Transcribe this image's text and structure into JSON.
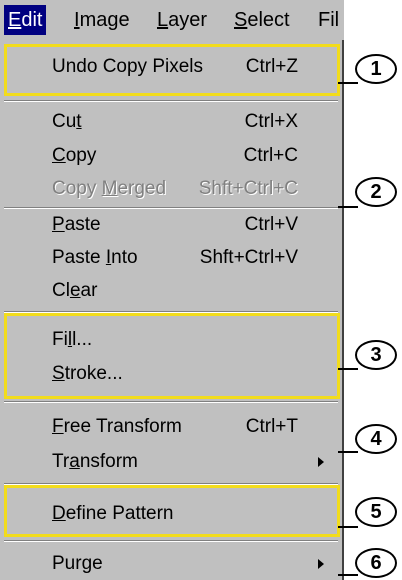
{
  "menubar": [
    {
      "name": "menu-edit",
      "pre": "",
      "acc": "E",
      "post": "dit",
      "active": true
    },
    {
      "name": "menu-image",
      "pre": "",
      "acc": "I",
      "post": "mage",
      "active": false
    },
    {
      "name": "menu-layer",
      "pre": "",
      "acc": "L",
      "post": "ayer",
      "active": false
    },
    {
      "name": "menu-select",
      "pre": "",
      "acc": "S",
      "post": "elect",
      "active": false
    },
    {
      "name": "menu-filter",
      "pre": "Fil",
      "acc": "",
      "post": "",
      "active": false
    }
  ],
  "items": [
    {
      "name": "undo-copy-pixels",
      "pre": "",
      "acc": "",
      "post": "Undo Copy Pixels",
      "shortcut": "Ctrl+Z",
      "disabled": false,
      "submenu": false
    },
    {
      "name": "cut",
      "pre": "Cu",
      "acc": "t",
      "post": "",
      "shortcut": "Ctrl+X",
      "disabled": false,
      "submenu": false
    },
    {
      "name": "copy",
      "pre": "",
      "acc": "C",
      "post": "opy",
      "shortcut": "Ctrl+C",
      "disabled": false,
      "submenu": false
    },
    {
      "name": "copy-merged",
      "pre": "Copy ",
      "acc": "M",
      "post": "erged",
      "shortcut": "Shft+Ctrl+C",
      "disabled": true,
      "submenu": false
    },
    {
      "name": "paste",
      "pre": "",
      "acc": "P",
      "post": "aste",
      "shortcut": "Ctrl+V",
      "disabled": false,
      "submenu": false
    },
    {
      "name": "paste-into",
      "pre": "Paste ",
      "acc": "I",
      "post": "nto",
      "shortcut": "Shft+Ctrl+V",
      "disabled": false,
      "submenu": false
    },
    {
      "name": "clear",
      "pre": "Cl",
      "acc": "e",
      "post": "ar",
      "shortcut": "",
      "disabled": false,
      "submenu": false
    },
    {
      "name": "fill",
      "pre": "Fi",
      "acc": "l",
      "post": "l...",
      "shortcut": "",
      "disabled": false,
      "submenu": false
    },
    {
      "name": "stroke",
      "pre": "",
      "acc": "S",
      "post": "troke...",
      "shortcut": "",
      "disabled": false,
      "submenu": false
    },
    {
      "name": "free-transform",
      "pre": "",
      "acc": "F",
      "post": "ree Transform",
      "shortcut": "Ctrl+T",
      "disabled": false,
      "submenu": false
    },
    {
      "name": "transform",
      "pre": "Tr",
      "acc": "a",
      "post": "nsform",
      "shortcut": "",
      "disabled": false,
      "submenu": true
    },
    {
      "name": "define-pattern",
      "pre": "",
      "acc": "D",
      "post": "efine Pattern",
      "shortcut": "",
      "disabled": false,
      "submenu": false
    },
    {
      "name": "purge",
      "pre": "Pur",
      "acc": "g",
      "post": "e",
      "shortcut": "",
      "disabled": false,
      "submenu": true
    }
  ],
  "callouts": [
    "1",
    "2",
    "3",
    "4",
    "5",
    "6"
  ],
  "colors": {
    "menu_bg": "#c0c0c0",
    "active_bg": "#000080",
    "highlight": "#f2dc1c",
    "disabled_text": "#808080"
  }
}
